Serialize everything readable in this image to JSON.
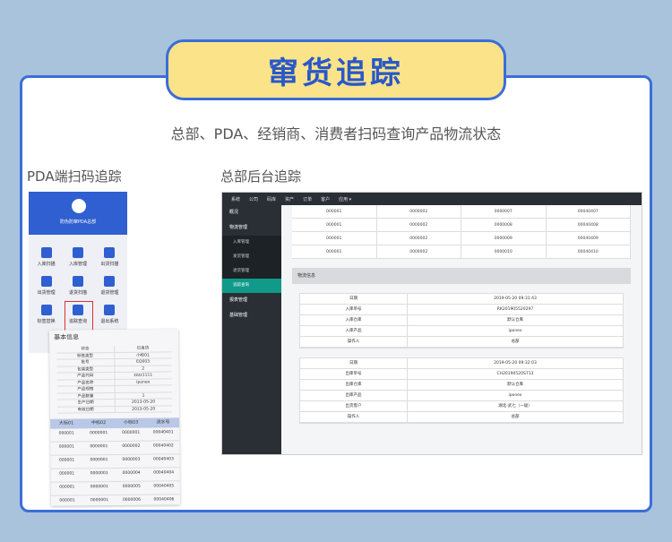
{
  "title": "窜货追踪",
  "subtitle": "总部、PDA、经销商、消费者扫码查询产品物流状态",
  "pda_section": "PDA端扫码追踪",
  "backend_section": "总部后台追踪",
  "pda": {
    "header": "防伪防窜PDA总部",
    "grid": [
      "入库扫描",
      "入库管理",
      "出货扫描",
      "出货管理",
      "退货扫描",
      "退货管理",
      "标签替换",
      "追踪查询",
      "退出系统"
    ],
    "highlight_index": 7
  },
  "info": {
    "title": "基本信息",
    "rows": [
      [
        "状态",
        "已发货"
      ],
      [
        "标签类型",
        "小标01"
      ],
      [
        "批号",
        "EQ003"
      ],
      [
        "包装类型",
        "2"
      ],
      [
        "产品代码",
        "zzzz1111"
      ],
      [
        "产品名称",
        "iponex"
      ],
      [
        "产品规格",
        ""
      ],
      [
        "产品数量",
        "1"
      ],
      [
        "生产日期",
        "2013-05-20"
      ],
      [
        "有效日期",
        "2013-05-20"
      ]
    ],
    "table_head": [
      "大标01",
      "中标02",
      "小标03",
      "流水号"
    ],
    "table_rows": [
      [
        "000001",
        "0000001",
        "0000001",
        "00040401"
      ],
      [
        "000001",
        "0000001",
        "0000002",
        "00040402"
      ],
      [
        "000001",
        "0000001",
        "0000003",
        "00040403"
      ],
      [
        "000001",
        "0000001",
        "0000004",
        "00040404"
      ],
      [
        "000001",
        "0000001",
        "0000005",
        "00040405"
      ],
      [
        "000001",
        "0000001",
        "0000006",
        "00040406"
      ]
    ]
  },
  "backend": {
    "topbar": [
      "系统",
      "公司",
      "码库",
      "资产",
      "订单",
      "客户",
      "应用 ▾"
    ],
    "sidebar": [
      {
        "label": "概况",
        "type": "group"
      },
      {
        "label": "物流管理",
        "type": "group"
      },
      {
        "label": "入库管理",
        "type": "sub"
      },
      {
        "label": "发货管理",
        "type": "sub"
      },
      {
        "label": "退货管理",
        "type": "sub"
      },
      {
        "label": "追踪查询",
        "type": "sub",
        "active": true
      },
      {
        "label": "报表管理",
        "type": "group"
      },
      {
        "label": "基础管理",
        "type": "group"
      }
    ],
    "grid": [
      [
        "000001",
        "0000002",
        "0000007",
        "00040407"
      ],
      [
        "000001",
        "0000002",
        "0000008",
        "00040408"
      ],
      [
        "000001",
        "0000002",
        "0000009",
        "00040409"
      ],
      [
        "000001",
        "0000002",
        "0000010",
        "00040410"
      ]
    ],
    "section": "物流信息",
    "in_block": [
      [
        "日期",
        "2019-05-20 09:31:43"
      ],
      [
        "入库单号",
        "RK201905520297"
      ],
      [
        "入库仓库",
        "默认仓库"
      ],
      [
        "入库产品",
        "iponex"
      ],
      [
        "操作人",
        "总部"
      ]
    ],
    "out_block": [
      [
        "日期",
        "2019-05-20 09:32:03"
      ],
      [
        "出库单号",
        "CH20190520S713"
      ],
      [
        "出库仓库",
        "默认仓库"
      ],
      [
        "出库产品",
        "iponex"
      ],
      [
        "出货客户",
        "湖北-武七（一级）"
      ],
      [
        "操作人",
        "总部"
      ]
    ]
  }
}
